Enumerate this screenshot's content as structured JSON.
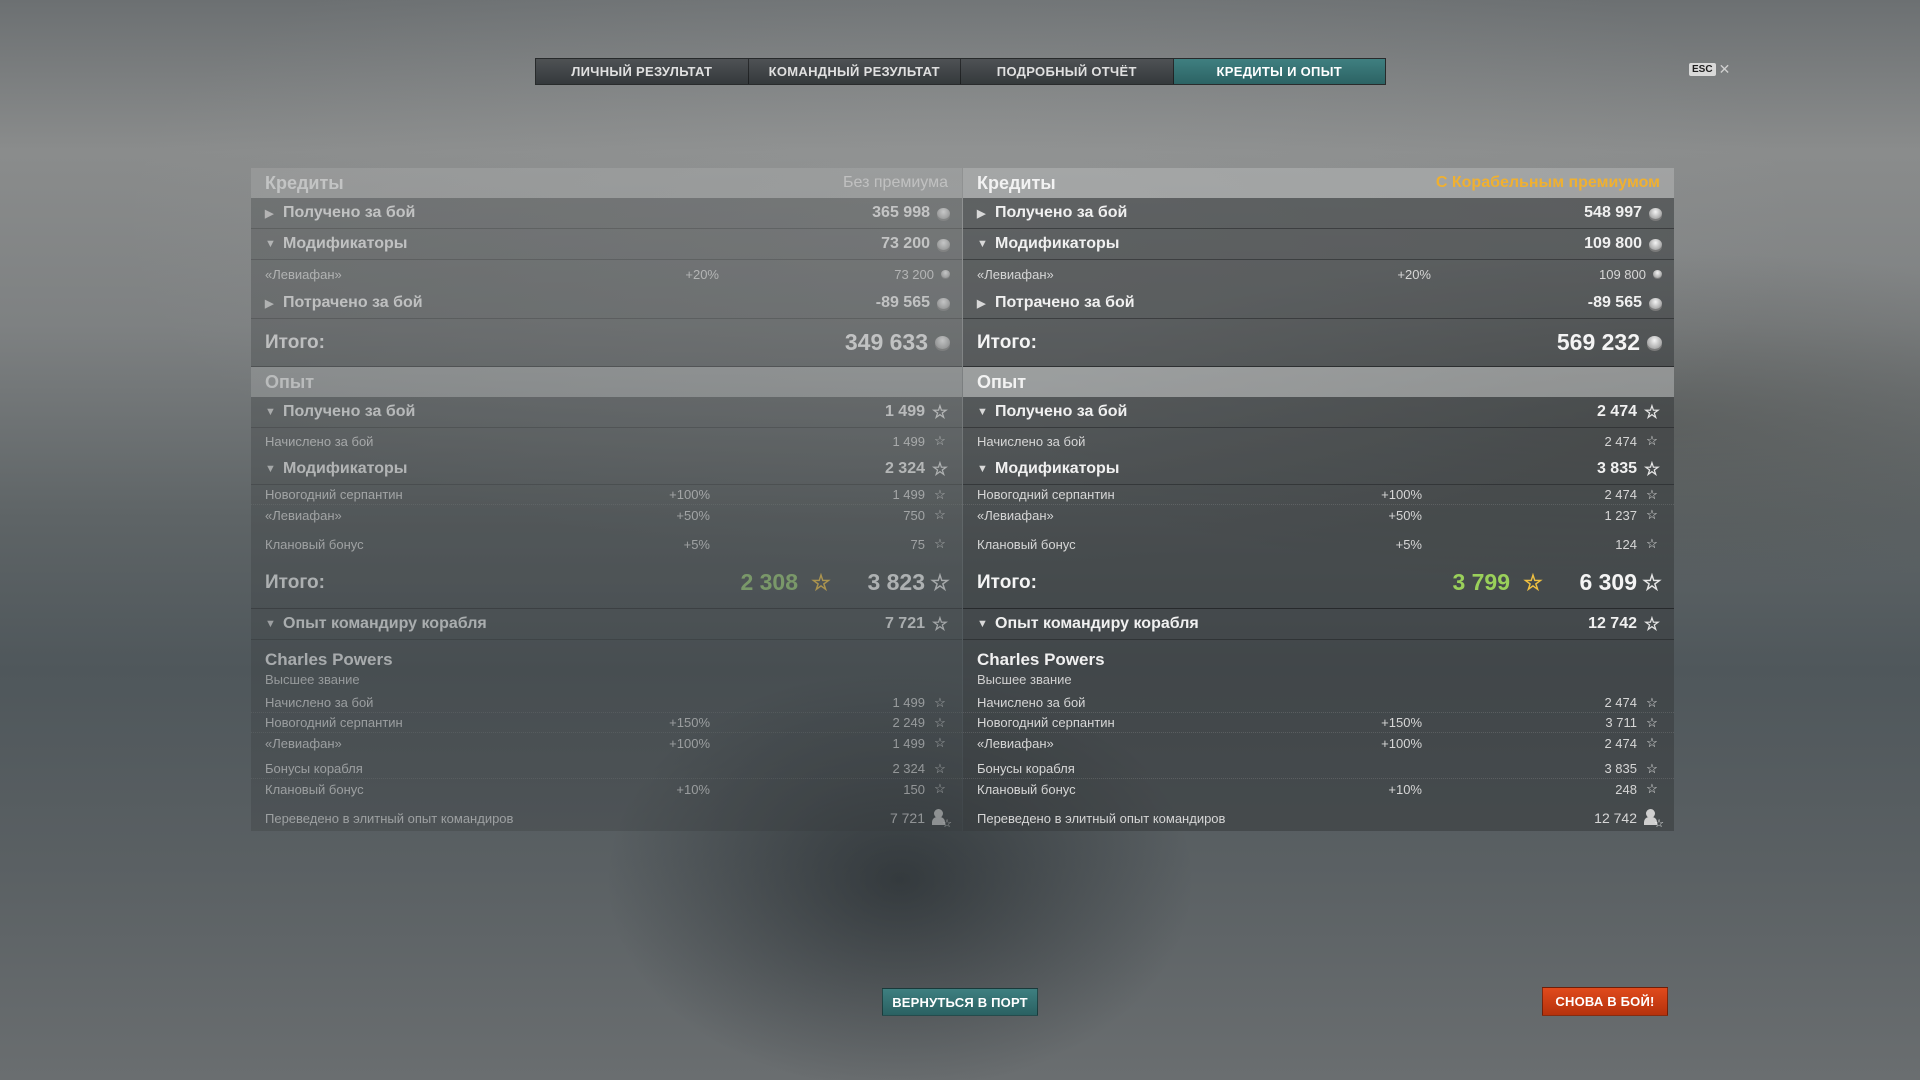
{
  "tabs": [
    {
      "label": "ЛИЧНЫЙ РЕЗУЛЬТАТ"
    },
    {
      "label": "КОМАНДНЫЙ РЕЗУЛЬТАТ"
    },
    {
      "label": "ПОДРОБНЫЙ ОТЧЁТ"
    },
    {
      "label": "КРЕДИТЫ И ОПЫТ",
      "active": true
    }
  ],
  "esc": {
    "key": "ESC",
    "close": "✕"
  },
  "left": {
    "credits_header": "Кредиты",
    "mode": "Без премиума",
    "credits_earned": {
      "label": "Получено за бой",
      "value": "365 998"
    },
    "credits_modifiers": {
      "label": "Модификаторы",
      "value": "73 200"
    },
    "leviathan_credits": {
      "label": "«Левиафан»",
      "pct": "+20%",
      "value": "73 200"
    },
    "credits_spent": {
      "label": "Потрачено за бой",
      "value": "-89 565"
    },
    "credits_total": {
      "label": "Итого:",
      "value": "349 633"
    },
    "xp_header": "Опыт",
    "xp_earned": {
      "label": "Получено за бой",
      "value": "1 499"
    },
    "xp_accrued": {
      "label": "Начислено за бой",
      "value": "1 499"
    },
    "xp_modifiers": {
      "label": "Модификаторы",
      "value": "2 324"
    },
    "xp_mod_rows": [
      {
        "label": "Новогодний серпантин",
        "pct": "+100%",
        "value": "1 499"
      },
      {
        "label": "«Левиафан»",
        "pct": "+50%",
        "value": "750"
      },
      {
        "label": "Клановый бонус",
        "pct": "+5%",
        "value": "75"
      }
    ],
    "xp_total": {
      "label": "Итого:",
      "green": "2 308",
      "value": "3 823"
    },
    "cmd_header": {
      "label": "Опыт командиру корабля",
      "value": "7 721"
    },
    "cmd_name": "Charles Powers",
    "cmd_rank": "Высшее звание",
    "cmd_rows": [
      {
        "label": "Начислено за бой",
        "pct": "",
        "value": "1 499"
      },
      {
        "label": "Новогодний серпантин",
        "pct": "+150%",
        "value": "2 249"
      },
      {
        "label": "«Левиафан»",
        "pct": "+100%",
        "value": "1 499"
      },
      {
        "label": "Бонусы корабля",
        "pct": "",
        "value": "2 324"
      },
      {
        "label": "Клановый бонус",
        "pct": "+10%",
        "value": "150"
      }
    ],
    "elite": {
      "label": "Переведено в элитный опыт командиров",
      "value": "7 721"
    }
  },
  "right": {
    "credits_header": "Кредиты",
    "mode": "С Корабельным премиумом",
    "credits_earned": {
      "label": "Получено за бой",
      "value": "548 997"
    },
    "credits_modifiers": {
      "label": "Модификаторы",
      "value": "109 800"
    },
    "leviathan_credits": {
      "label": "«Левиафан»",
      "pct": "+20%",
      "value": "109 800"
    },
    "credits_spent": {
      "label": "Потрачено за бой",
      "value": "-89 565"
    },
    "credits_total": {
      "label": "Итого:",
      "value": "569 232"
    },
    "xp_header": "Опыт",
    "xp_earned": {
      "label": "Получено за бой",
      "value": "2 474"
    },
    "xp_accrued": {
      "label": "Начислено за бой",
      "value": "2 474"
    },
    "xp_modifiers": {
      "label": "Модификаторы",
      "value": "3 835"
    },
    "xp_mod_rows": [
      {
        "label": "Новогодний серпантин",
        "pct": "+100%",
        "value": "2 474"
      },
      {
        "label": "«Левиафан»",
        "pct": "+50%",
        "value": "1 237"
      },
      {
        "label": "Клановый бонус",
        "pct": "+5%",
        "value": "124"
      }
    ],
    "xp_total": {
      "label": "Итого:",
      "green": "3 799",
      "value": "6 309"
    },
    "cmd_header": {
      "label": "Опыт командиру корабля",
      "value": "12 742"
    },
    "cmd_name": "Charles Powers",
    "cmd_rank": "Высшее звание",
    "cmd_rows": [
      {
        "label": "Начислено за бой",
        "pct": "",
        "value": "2 474"
      },
      {
        "label": "Новогодний серпантин",
        "pct": "+150%",
        "value": "3 711"
      },
      {
        "label": "«Левиафан»",
        "pct": "+100%",
        "value": "2 474"
      },
      {
        "label": "Бонусы корабля",
        "pct": "",
        "value": "3 835"
      },
      {
        "label": "Клановый бонус",
        "pct": "+10%",
        "value": "248"
      }
    ],
    "elite": {
      "label": "Переведено в элитный опыт командиров",
      "value": "12 742"
    }
  },
  "buttons": {
    "port": "ВЕРНУТЬСЯ В ПОРТ",
    "battle": "СНОВА В БОЙ!"
  },
  "colors": {
    "accent": "#2f6b6c",
    "premium": "#f0b030",
    "battle": "#d2401a",
    "bonus_xp": "#9ad05a"
  }
}
